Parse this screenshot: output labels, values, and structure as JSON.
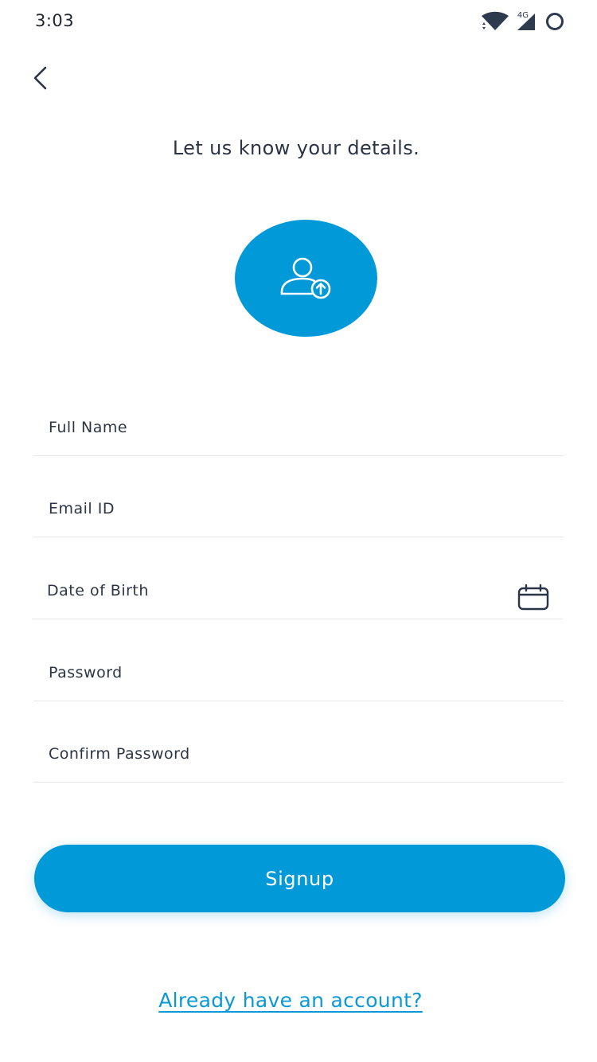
{
  "status_bar": {
    "time": "3:03",
    "network_label": "4G",
    "icons": [
      "wifi-icon",
      "cellular-signal-icon",
      "battery-icon"
    ]
  },
  "nav": {
    "back_icon": "chevron-left-icon"
  },
  "header": {
    "title": "Let us know your details."
  },
  "avatar": {
    "icon": "user-upload-icon",
    "color": "#0199d8"
  },
  "form": {
    "full_name": {
      "label": "Full Name",
      "value": ""
    },
    "email": {
      "label": "Email ID",
      "value": ""
    },
    "date_of_birth": {
      "label": "Date of Birth",
      "value": "",
      "icon": "calendar-icon"
    },
    "password": {
      "label": "Password",
      "value": ""
    },
    "confirm_password": {
      "label": "Confirm Password",
      "value": ""
    }
  },
  "actions": {
    "signup_label": "Signup",
    "login_link": "Already have an account?"
  },
  "colors": {
    "primary": "#0199d8",
    "text": "#2b3446",
    "divider": "#e3e6ea"
  }
}
